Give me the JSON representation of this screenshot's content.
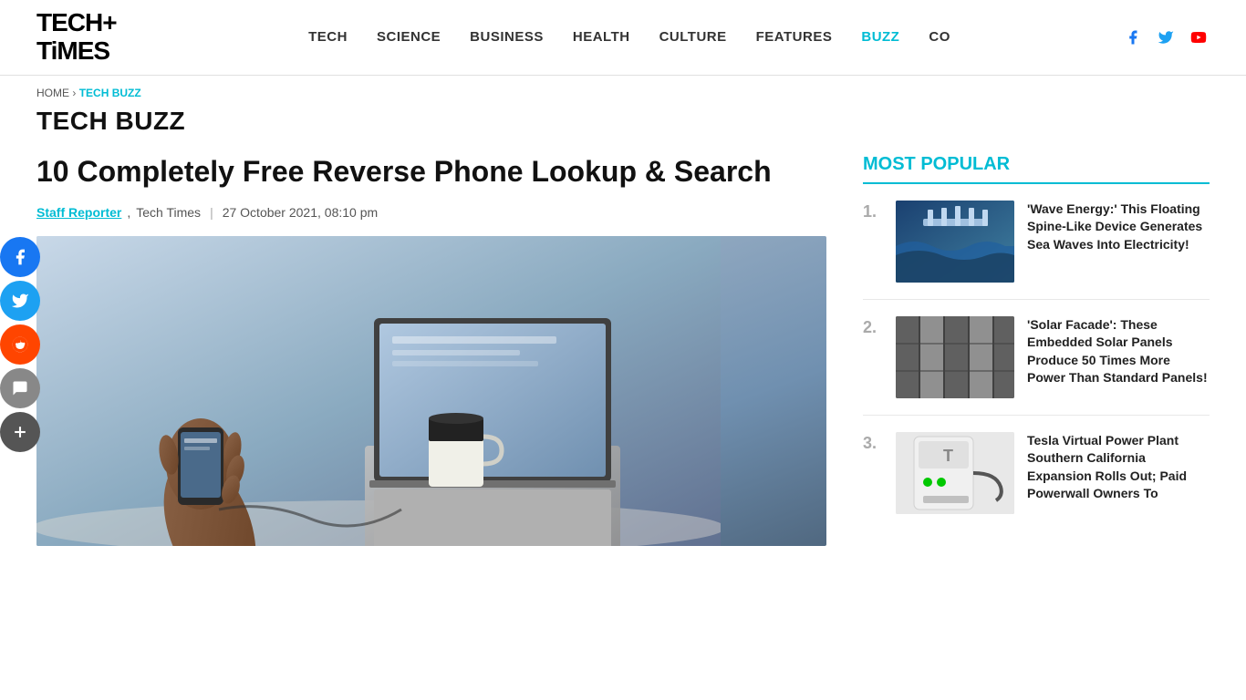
{
  "header": {
    "logo_line1": "TECH+",
    "logo_line2": "TiMES",
    "nav_items": [
      {
        "label": "TECH",
        "active": false
      },
      {
        "label": "SCIENCE",
        "active": false
      },
      {
        "label": "BUSINESS",
        "active": false
      },
      {
        "label": "HEALTH",
        "active": false
      },
      {
        "label": "CULTURE",
        "active": false
      },
      {
        "label": "FEATURES",
        "active": false
      },
      {
        "label": "BUZZ",
        "active": true
      },
      {
        "label": "CO",
        "active": false
      }
    ]
  },
  "breadcrumb": {
    "home": "HOME",
    "separator": "›",
    "current": "TECH BUZZ"
  },
  "section_title": "TECH BUZZ",
  "article": {
    "title": "10 Completely Free Reverse Phone Lookup & Search",
    "author": "Staff Reporter",
    "source": "Tech Times",
    "date": "27 October 2021, 08:10 pm"
  },
  "sidebar": {
    "most_popular_title": "MOST POPULAR",
    "items": [
      {
        "num": "1.",
        "text": "'Wave Energy:' This Floating Spine-Like Device Generates Sea Waves Into Electricity!"
      },
      {
        "num": "2.",
        "text": "'Solar Facade': These Embedded Solar Panels Produce 50 Times More Power Than Standard Panels!"
      },
      {
        "num": "3.",
        "text": "Tesla Virtual Power Plant Southern California Expansion Rolls Out; Paid Powerwall Owners To"
      }
    ]
  },
  "social_sidebar": {
    "fb_label": "Facebook",
    "tw_label": "Twitter",
    "rd_label": "Reddit",
    "ch_label": "Chat",
    "plus_label": "More"
  },
  "icons": {
    "facebook": "f",
    "twitter": "t",
    "youtube": "▶",
    "reddit": "r",
    "chat": "💬",
    "plus": "+"
  }
}
